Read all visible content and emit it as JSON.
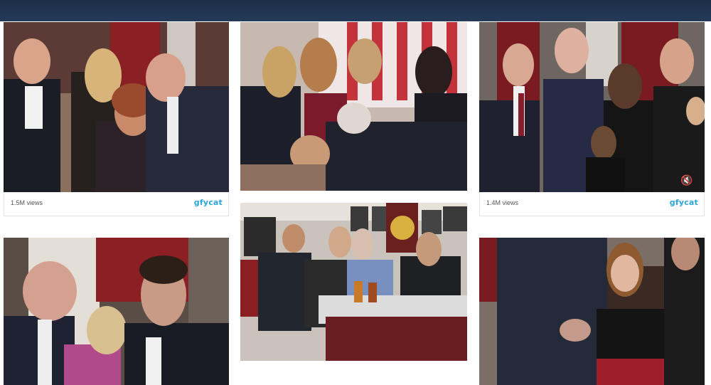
{
  "cards": [
    {
      "views": "1.5M views",
      "brand": "gfycat"
    },
    {
      "views": "1.4M views",
      "brand": "gfycat"
    }
  ],
  "icons": {
    "mute": "speaker-muted-icon",
    "brand": "gfycat-logo"
  },
  "colors": {
    "topbar": "#1c2f4a",
    "brand": "#2da6d6"
  }
}
